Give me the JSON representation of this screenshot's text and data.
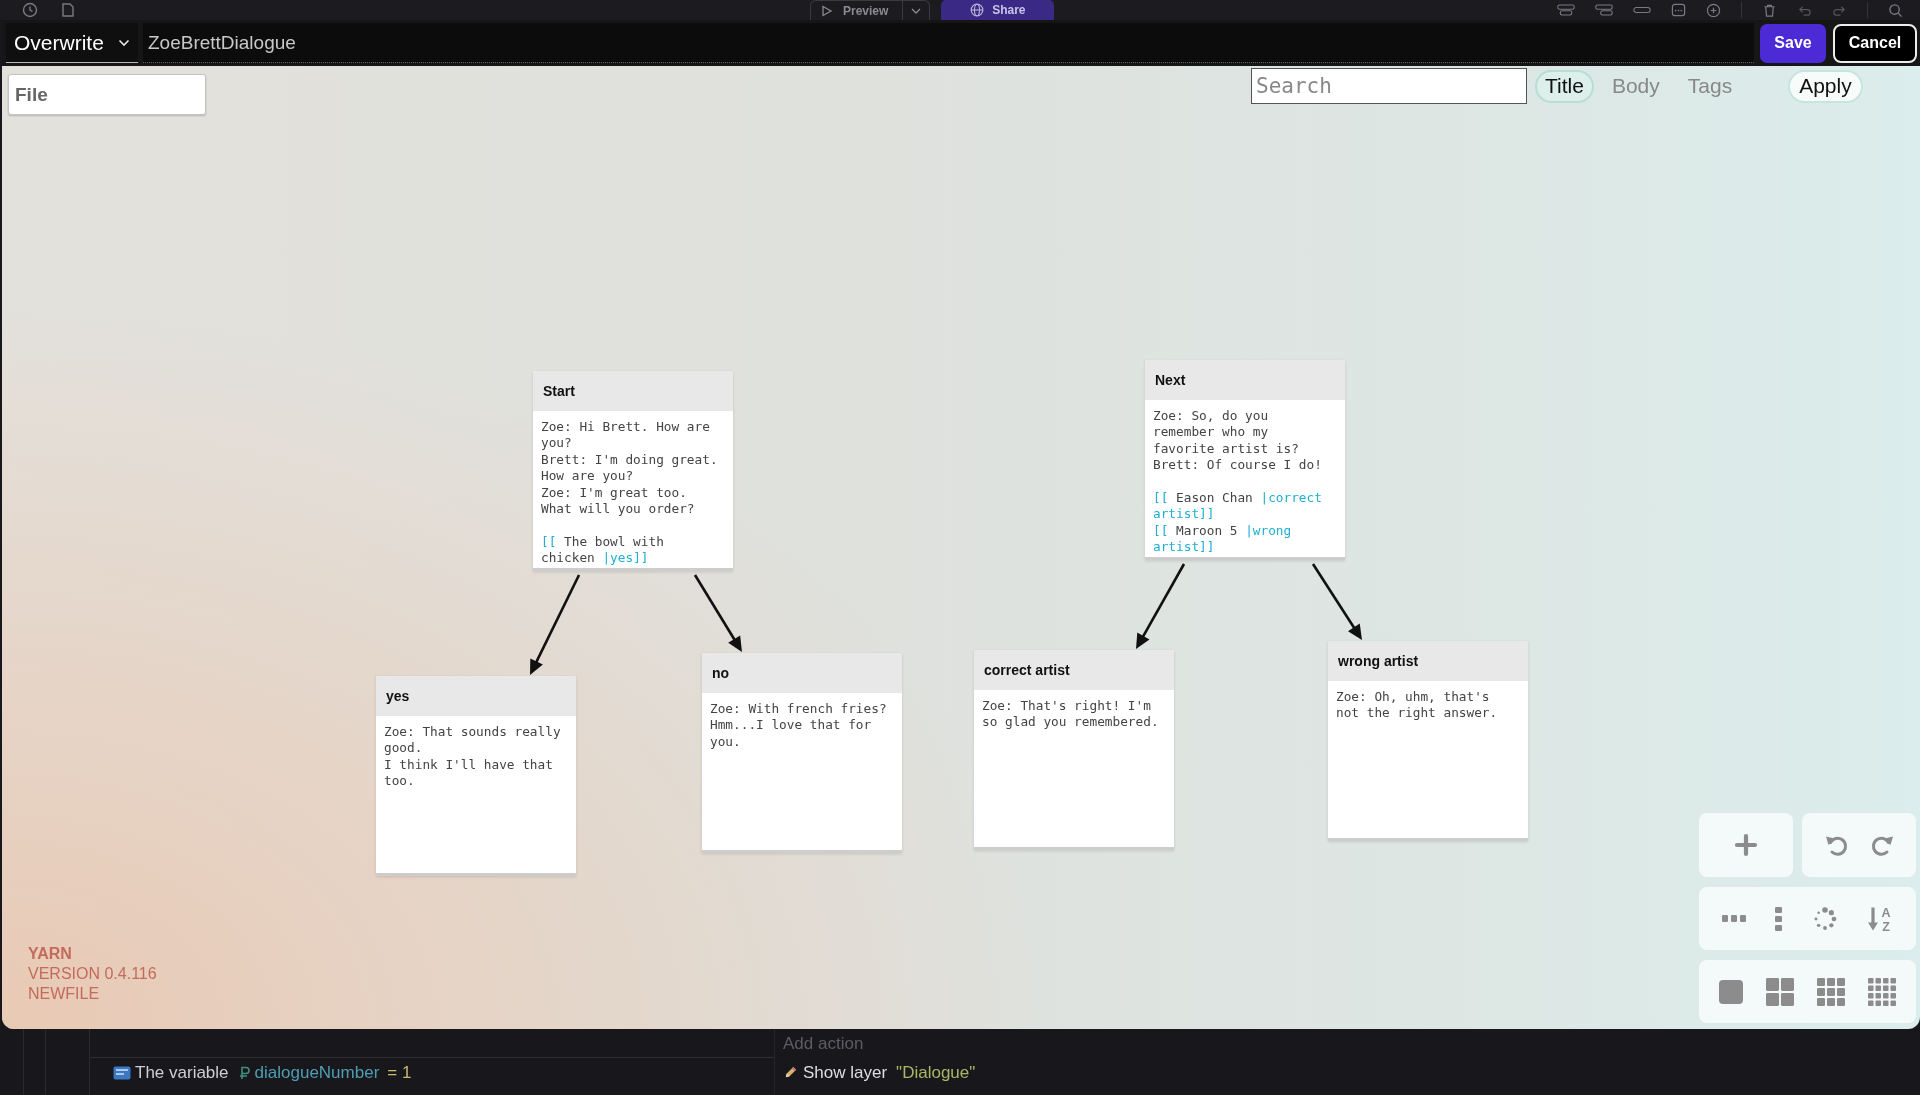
{
  "background_app": {
    "toolbar": {
      "preview_button": "Preview",
      "share_button": "Share"
    },
    "event_sheet": {
      "condition": {
        "text": "The variable",
        "variable": "dialogueNumber",
        "comparison": "= 1"
      },
      "add_action": "Add action",
      "actions": [
        {
          "text": "Show layer",
          "argument": "\"Dialogue\""
        }
      ]
    }
  },
  "dialog": {
    "mode_select": "Overwrite",
    "filename": "ZoeBrettDialogue",
    "save_button": "Save",
    "cancel_button": "Cancel",
    "file_button": "File",
    "search": {
      "placeholder": "Search",
      "filters": [
        {
          "label": "Title",
          "selected": true
        },
        {
          "label": "Body",
          "selected": false
        },
        {
          "label": "Tags",
          "selected": false
        }
      ],
      "apply_button": "Apply"
    },
    "nodes": [
      {
        "title": "Start",
        "body": [
          {
            "kind": "text",
            "text": "Zoe: Hi Brett. How are you?\nBrett: I'm doing great. How are you?\nZoe: I'm great too. What will you order?\n\n"
          },
          {
            "kind": "link",
            "text": "[["
          },
          {
            "kind": "text",
            "text": " The bowl with chicken "
          },
          {
            "kind": "link",
            "text": "|yes]]"
          }
        ],
        "children": [
          {
            "title": "yes",
            "body": [
              {
                "kind": "text",
                "text": "Zoe: That sounds really good.\nI think I'll have that too."
              }
            ]
          },
          {
            "title": "no",
            "body": [
              {
                "kind": "text",
                "text": "Zoe: With french fries? Hmm...I love that for you."
              }
            ]
          }
        ]
      },
      {
        "title": "Next",
        "body": [
          {
            "kind": "text",
            "text": "Zoe: So, do you remember who my favorite artist is?\nBrett: Of course I do!\n\n"
          },
          {
            "kind": "link",
            "text": "[["
          },
          {
            "kind": "text",
            "text": " Eason Chan "
          },
          {
            "kind": "link",
            "text": "|correct artist]]\n[["
          },
          {
            "kind": "text",
            "text": " Maroon 5 "
          },
          {
            "kind": "link",
            "text": "|wrong artist]]"
          }
        ],
        "children": [
          {
            "title": "correct artist",
            "body": [
              {
                "kind": "text",
                "text": "Zoe: That's right! I'm so glad you remembered."
              }
            ]
          },
          {
            "title": "wrong artist",
            "body": [
              {
                "kind": "text",
                "text": "Zoe: Oh, uhm, that's not the right answer."
              }
            ]
          }
        ]
      }
    ],
    "app_info": {
      "name": "YARN",
      "version": "VERSION 0.4.116",
      "file": "NEWFILE"
    },
    "view_tools": {
      "sort_letters": [
        "A",
        "Z"
      ]
    }
  }
}
